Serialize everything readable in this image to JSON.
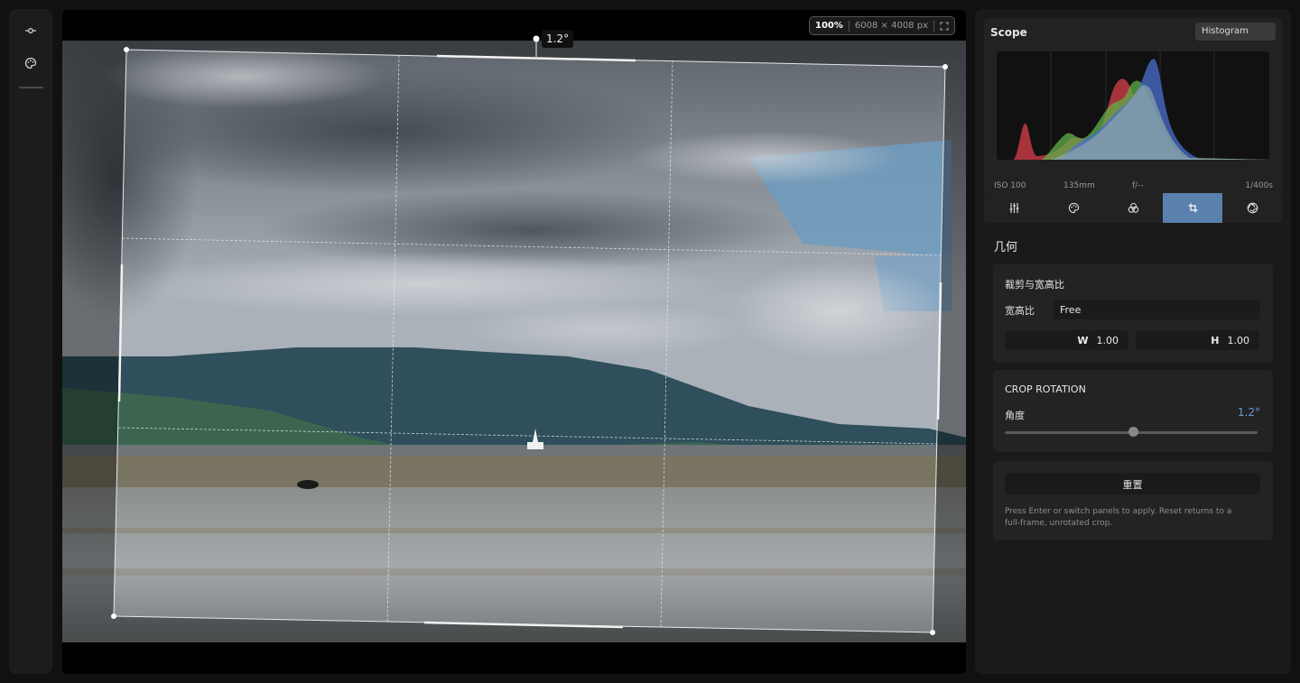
{
  "left_rail": {
    "items": [
      {
        "icon": "commit-icon"
      },
      {
        "icon": "palette-icon"
      }
    ]
  },
  "viewer": {
    "zoom": "100%",
    "image_size": "6008 × 4008 px",
    "rotation_tag": "1.2°"
  },
  "scope": {
    "title": "Scope",
    "mode": "Histogram",
    "exif": {
      "iso": "ISO 100",
      "focal": "135mm",
      "aperture": "f/--",
      "shutter": "1/400s"
    }
  },
  "tool_tabs": [
    {
      "icon": "sliders-icon",
      "active": false
    },
    {
      "icon": "palette-icon",
      "active": false
    },
    {
      "icon": "color-circles-icon",
      "active": false
    },
    {
      "icon": "crop-icon",
      "active": true
    },
    {
      "icon": "aperture-icon",
      "active": false
    }
  ],
  "geometry": {
    "title": "几何",
    "crop": {
      "title": "裁剪与宽高比",
      "aspect_label": "宽高比",
      "aspect_value": "Free",
      "w_label": "W",
      "w_value": "1.00",
      "h_label": "H",
      "h_value": "1.00"
    },
    "rotation": {
      "title": "CROP ROTATION",
      "angle_label": "角度",
      "angle_value": "1.2°",
      "slider_fraction": 0.51
    },
    "reset": {
      "label": "重置",
      "hint": "Press Enter or switch panels to apply. Reset returns to a full-frame, unrotated crop."
    }
  },
  "colors": {
    "accent": "#5a80ad",
    "angle_value": "#6a9ad4"
  }
}
